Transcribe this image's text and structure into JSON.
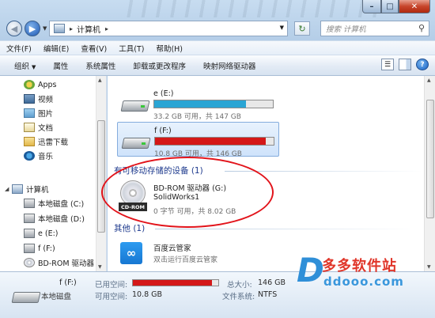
{
  "window": {
    "caption": {
      "minimize": "–",
      "maximize": "□",
      "close": "✕"
    }
  },
  "address": {
    "separator": "▸",
    "location": "计算机",
    "location_suffix": "▸",
    "search_placeholder": "搜索 计算机"
  },
  "menubar": {
    "items": [
      "文件(F)",
      "编辑(E)",
      "查看(V)",
      "工具(T)",
      "帮助(H)"
    ]
  },
  "toolbar": {
    "items": [
      "组织",
      "属性",
      "系统属性",
      "卸载或更改程序",
      "映射网络驱动器"
    ],
    "dropdown_marker": "▼"
  },
  "sidebar": {
    "items": [
      {
        "label": "Apps",
        "icon": "apps-icon"
      },
      {
        "label": "视频",
        "icon": "video-library-icon"
      },
      {
        "label": "图片",
        "icon": "pictures-library-icon"
      },
      {
        "label": "文档",
        "icon": "documents-library-icon"
      },
      {
        "label": "迅雷下载",
        "icon": "folder-icon"
      },
      {
        "label": "音乐",
        "icon": "music-library-icon"
      }
    ],
    "computer": "计算机",
    "drives": [
      {
        "label": "本地磁盘 (C:)"
      },
      {
        "label": "本地磁盘 (D:)"
      },
      {
        "label": "e (E:)"
      },
      {
        "label": "f (F:)"
      },
      {
        "label": "BD-ROM 驱动器"
      }
    ]
  },
  "content": {
    "drives": [
      {
        "name": "e (E:)",
        "info": "33.2 GB 可用，共 147 GB",
        "used_fraction": 0.77,
        "bar_color": "#2aa5d4"
      },
      {
        "name": "f (F:)",
        "info": "10.8 GB 可用，共 146 GB",
        "used_fraction": 0.93,
        "bar_color": "#d41818"
      }
    ],
    "removable_group": "有可移动存储的设备 (1)",
    "cd": {
      "name": "BD-ROM 驱动器 (G:)",
      "label": "SolidWorks1",
      "info": "0 字节 可用，共 8.02 GB",
      "tag": "CD-ROM"
    },
    "other_group": "其他 (1)",
    "baidu": {
      "name": "百度云管家",
      "desc": "双击运行百度云管家"
    }
  },
  "details": {
    "name": "f (F:)",
    "type": "本地磁盘",
    "used_label": "已用空间:",
    "free_label": "可用空间:",
    "free_value": "10.8 GB",
    "total_label": "总大小:",
    "total_value": "146 GB",
    "fs_label": "文件系统:",
    "fs_value": "NTFS"
  },
  "watermark": {
    "logo": "D",
    "cn": "多多软件站",
    "en": "ddooo.com"
  },
  "colors": {
    "accent": "#1f3b8e",
    "selection": "#cfe3fb",
    "highlight_ring": "#e2141b"
  }
}
